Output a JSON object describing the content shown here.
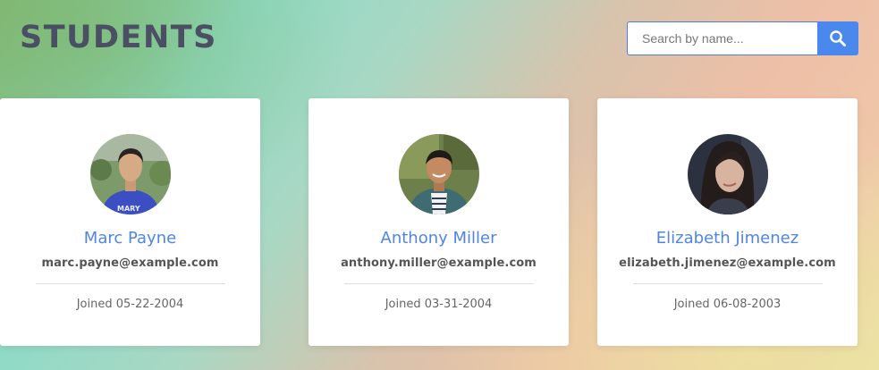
{
  "page": {
    "title": "STUDENTS"
  },
  "search": {
    "placeholder": "Search by name...",
    "value": "",
    "button_icon": "search-icon",
    "accent": "#4a88ee"
  },
  "students": [
    {
      "name": "Anthony Miller",
      "email": "anthony.miller@example.com",
      "joined_label": "Joined",
      "joined_date": "03-31-2004"
    },
    {
      "name": "Elizabeth Jimenez",
      "email": "elizabeth.jimenez@example.com",
      "joined_label": "Joined",
      "joined_date": "06-08-2003"
    },
    {
      "name": "Marc Payne",
      "email": "marc.payne@example.com",
      "joined_label": "Joined",
      "joined_date": "05-22-2004"
    }
  ]
}
